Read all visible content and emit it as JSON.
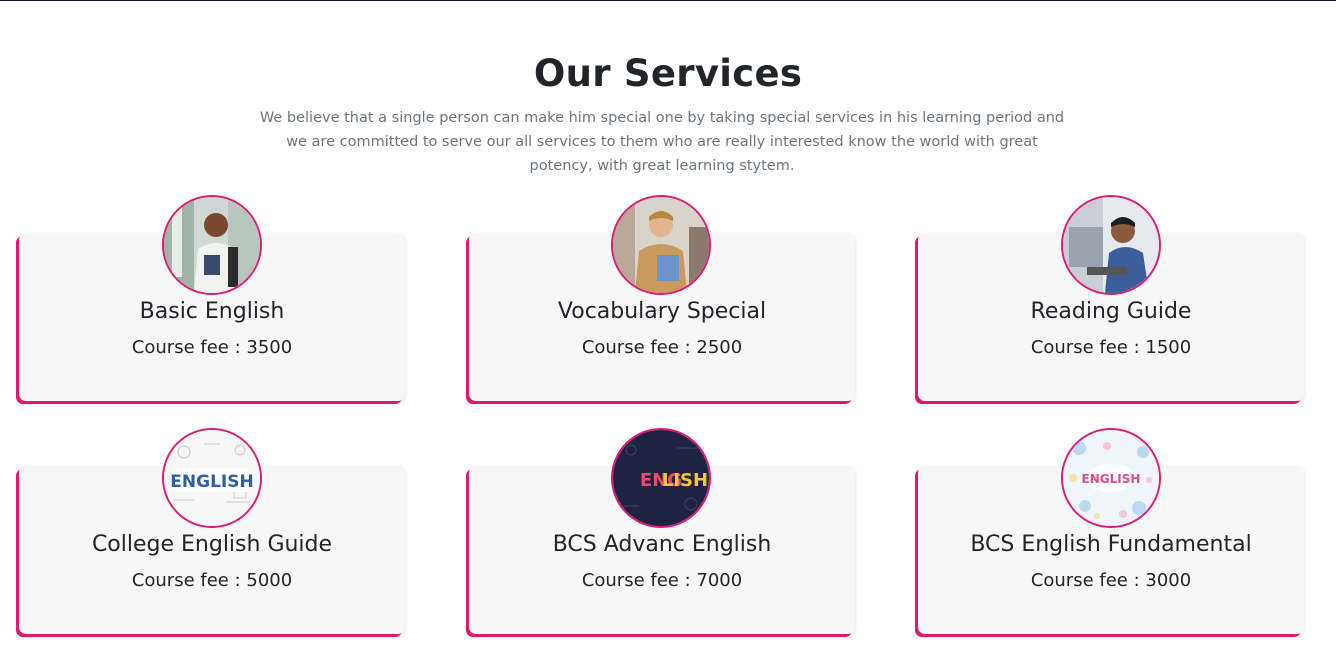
{
  "section": {
    "title": "Our Services",
    "description": "We believe that a single person can make him special one by taking special services in his learning period and we are committed to serve our all services to them who are really interested know the world with great potency, with great learning stytem."
  },
  "services": [
    {
      "title": "Basic English",
      "fee": "Course fee : 3500",
      "image": "student-with-backpack-photo"
    },
    {
      "title": "Vocabulary Special",
      "fee": "Course fee : 2500",
      "image": "student-with-folder-photo"
    },
    {
      "title": "Reading Guide",
      "fee": "Course fee : 1500",
      "image": "student-at-laptop-photo"
    },
    {
      "title": "College English Guide",
      "fee": "Course fee : 5000",
      "image": "english-word-sketch-graphic"
    },
    {
      "title": "BCS Advanc English",
      "fee": "Course fee : 7000",
      "image": "english-neon-graphic"
    },
    {
      "title": "BCS English Fundamental",
      "fee": "Course fee : 3000",
      "image": "english-doodle-graphic"
    }
  ],
  "colors": {
    "accent": "#e0186e",
    "card_bg": "#f7f7f7",
    "text": "#212529",
    "muted": "#6c757d"
  }
}
